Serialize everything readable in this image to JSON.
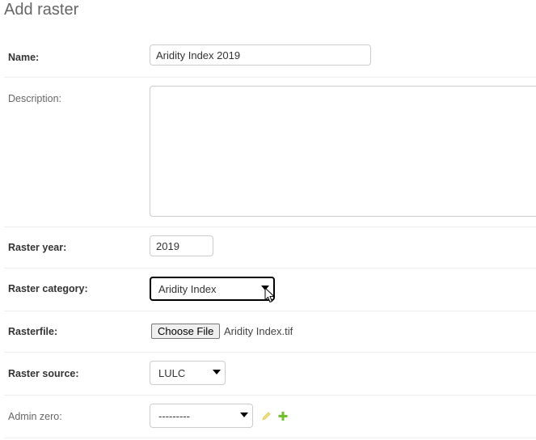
{
  "page": {
    "title": "Add raster"
  },
  "fields": {
    "name": {
      "label": "Name:",
      "value": "Aridity Index 2019"
    },
    "description": {
      "label": "Description:",
      "value": ""
    },
    "raster_year": {
      "label": "Raster year:",
      "value": "2019"
    },
    "raster_category": {
      "label": "Raster category:",
      "selected": "Aridity Index"
    },
    "rasterfile": {
      "label": "Rasterfile:",
      "button": "Choose File",
      "filename": "Aridity Index.tif"
    },
    "raster_source": {
      "label": "Raster source:",
      "selected": "LULC"
    },
    "admin_zero": {
      "label": "Admin zero:",
      "selected": "---------"
    }
  },
  "icons": {
    "edit": "pencil-icon",
    "add": "plus-icon",
    "cursor": "mouse-pointer-icon"
  },
  "colors": {
    "edit_icon": "#efe37a",
    "add_icon": "#70bf2b",
    "focus_border": "#000000"
  }
}
